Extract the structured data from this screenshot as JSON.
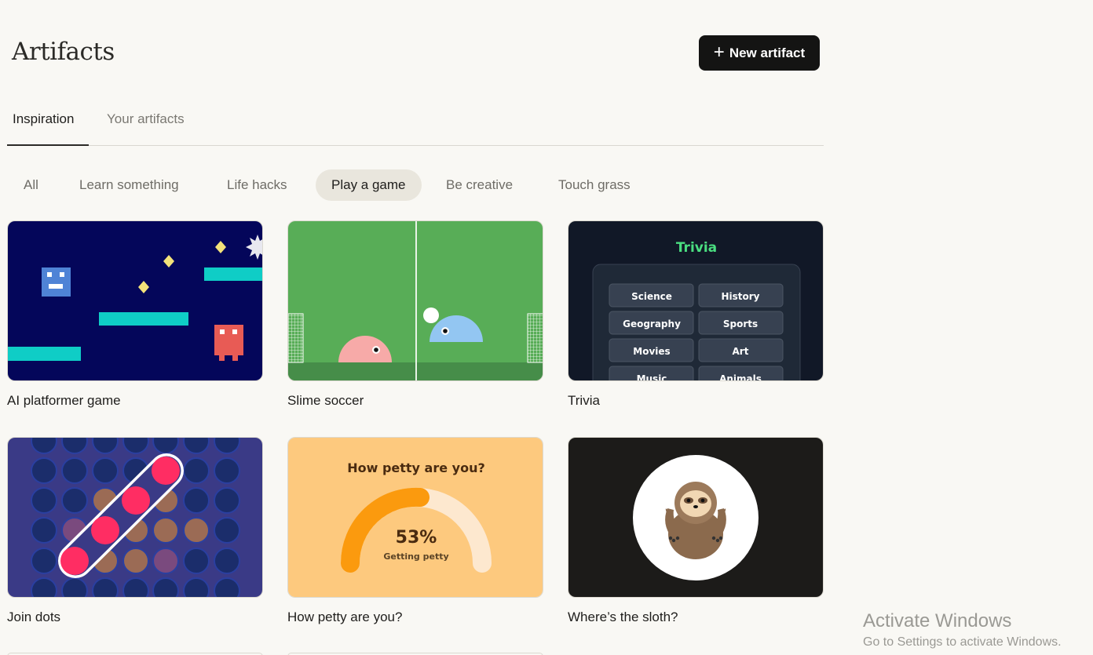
{
  "header": {
    "title": "Artifacts",
    "new_button": "New artifact"
  },
  "tabs": [
    {
      "label": "Inspiration",
      "active": true
    },
    {
      "label": "Your artifacts",
      "active": false
    }
  ],
  "filters": [
    {
      "label": "All",
      "active": false
    },
    {
      "label": "Learn something",
      "active": false
    },
    {
      "label": "Life hacks",
      "active": false
    },
    {
      "label": "Play a game",
      "active": true
    },
    {
      "label": "Be creative",
      "active": false
    },
    {
      "label": "Touch grass",
      "active": false
    }
  ],
  "cards": [
    {
      "label": "AI platformer game"
    },
    {
      "label": "Slime soccer"
    },
    {
      "label": "Trivia",
      "thumb_title": "Trivia",
      "categories": [
        "Science",
        "History",
        "Geography",
        "Sports",
        "Movies",
        "Art",
        "Music",
        "Animals"
      ]
    },
    {
      "label": "Join dots"
    },
    {
      "label": "How petty are you?",
      "thumb_title": "How petty are you?",
      "percent": "53%",
      "status": "Getting petty",
      "gauge_level": 0.53
    },
    {
      "label": "Where’s the sloth?"
    }
  ],
  "watermark": {
    "title": "Activate Windows",
    "subtitle": "Go to Settings to activate Windows."
  },
  "colors": {
    "primary_button": "#141413",
    "background": "#f9f8f4",
    "active_chip": "#e9e6dd"
  }
}
